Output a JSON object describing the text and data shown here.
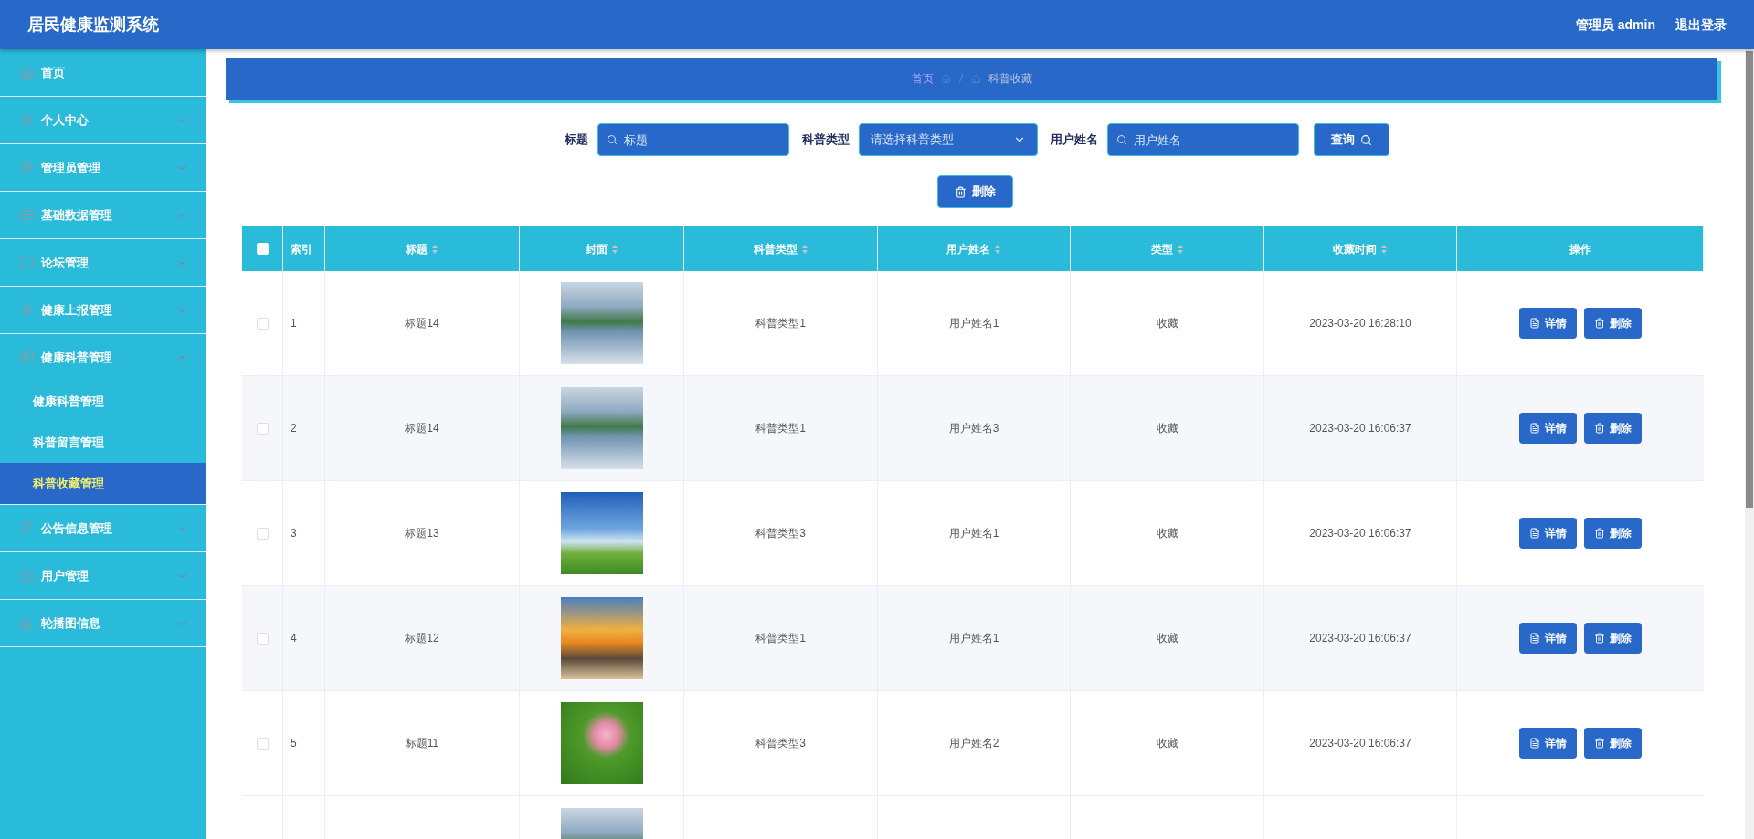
{
  "header": {
    "title": "居民健康监测系统",
    "user": "管理员 admin",
    "logout": "退出登录"
  },
  "sidebar": {
    "items": [
      {
        "label": "首页",
        "kind": "link"
      },
      {
        "label": "个人中心",
        "kind": "menu",
        "expanded": false
      },
      {
        "label": "管理员管理",
        "kind": "menu",
        "expanded": false
      },
      {
        "label": "基础数据管理",
        "kind": "menu",
        "expanded": false
      },
      {
        "label": "论坛管理",
        "kind": "menu",
        "expanded": false
      },
      {
        "label": "健康上报管理",
        "kind": "menu",
        "expanded": false
      },
      {
        "label": "健康科普管理",
        "kind": "menu",
        "expanded": true,
        "children": [
          {
            "label": "健康科普管理",
            "selected": false
          },
          {
            "label": "科普留言管理",
            "selected": false
          },
          {
            "label": "科普收藏管理",
            "selected": true
          }
        ]
      },
      {
        "label": "公告信息管理",
        "kind": "menu",
        "expanded": false
      },
      {
        "label": "用户管理",
        "kind": "menu",
        "expanded": false
      },
      {
        "label": "轮播图信息",
        "kind": "menu",
        "expanded": false
      }
    ]
  },
  "breadcrumb": {
    "home": "首页",
    "current": "科普收藏"
  },
  "search": {
    "fields": [
      {
        "label": "标题",
        "kind": "input",
        "placeholder": "标题"
      },
      {
        "label": "科普类型",
        "kind": "select",
        "placeholder": "请选择科普类型"
      },
      {
        "label": "用户姓名",
        "kind": "input",
        "placeholder": "用户姓名"
      }
    ],
    "query_button": "查询",
    "delete_button": "删除"
  },
  "table": {
    "all_checked": false,
    "columns": [
      {
        "label": "索引",
        "sortable": false
      },
      {
        "label": "标题",
        "sortable": true
      },
      {
        "label": "封面",
        "sortable": true
      },
      {
        "label": "科普类型",
        "sortable": true
      },
      {
        "label": "用户姓名",
        "sortable": true
      },
      {
        "label": "类型",
        "sortable": true
      },
      {
        "label": "收藏时间",
        "sortable": true
      },
      {
        "label": "操作",
        "sortable": false
      }
    ],
    "rows": [
      {
        "selected": false,
        "index": "1",
        "title": "标题14",
        "category": "科普类型1",
        "user": "用户姓名1",
        "type": "收藏",
        "time": "2023-03-20 16:28:10",
        "detail_button": "详情",
        "delete_button": "删除"
      },
      {
        "selected": false,
        "index": "2",
        "title": "标题14",
        "category": "科普类型1",
        "user": "用户姓名3",
        "type": "收藏",
        "time": "2023-03-20 16:06:37",
        "detail_button": "详情",
        "delete_button": "删除"
      },
      {
        "selected": false,
        "index": "3",
        "title": "标题13",
        "category": "科普类型3",
        "user": "用户姓名1",
        "type": "收藏",
        "time": "2023-03-20 16:06:37",
        "detail_button": "详情",
        "delete_button": "删除"
      },
      {
        "selected": false,
        "index": "4",
        "title": "标题12",
        "category": "科普类型1",
        "user": "用户姓名1",
        "type": "收藏",
        "time": "2023-03-20 16:06:37",
        "detail_button": "详情",
        "delete_button": "删除"
      },
      {
        "selected": false,
        "index": "5",
        "title": "标题11",
        "category": "科普类型3",
        "user": "用户姓名2",
        "type": "收藏",
        "time": "2023-03-20 16:06:37",
        "detail_button": "详情",
        "delete_button": "删除"
      }
    ]
  }
}
